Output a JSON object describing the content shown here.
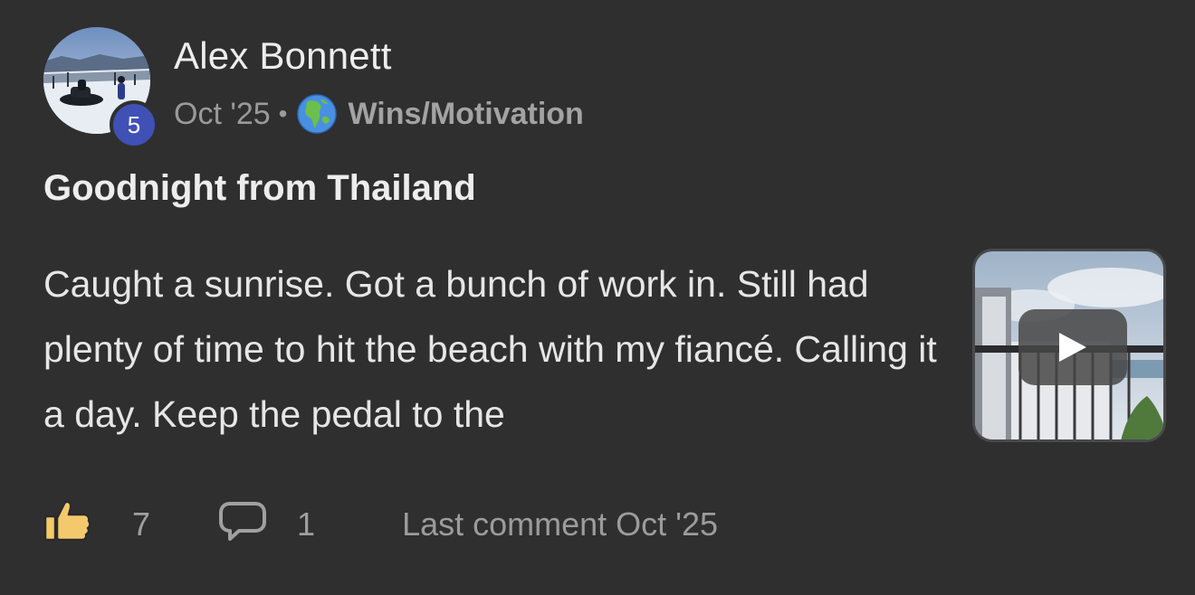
{
  "post": {
    "author": "Alex Bonnett",
    "level": "5",
    "date": "Oct '25",
    "separator": "•",
    "category": "Wins/Motivation",
    "category_icon": "globe-icon",
    "title": "Goodnight from Thailand",
    "body": "Caught a sunrise. Got a bunch of work in. Still had plenty of time to hit the beach with my fiancé. Calling it a day. Keep the pedal to the",
    "media": {
      "type": "video",
      "icon": "play-icon"
    }
  },
  "footer": {
    "likes": "7",
    "like_icon": "thumbs-up-icon",
    "comments": "1",
    "comment_icon": "comment-bubble-icon",
    "last_comment": "Last comment Oct '25"
  },
  "colors": {
    "background": "#2f2f30",
    "badge": "#3f51b5",
    "thumb": "#f3c96b",
    "text_primary": "#ededed",
    "text_secondary": "#9a9a9a"
  }
}
